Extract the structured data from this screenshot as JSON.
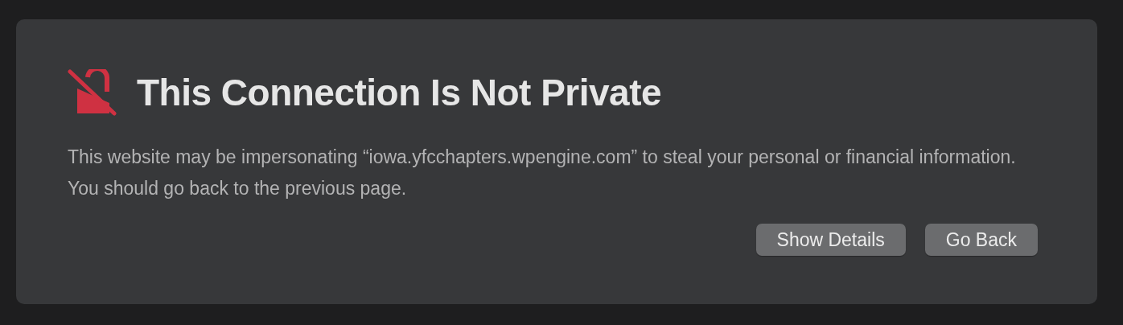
{
  "dialog": {
    "title": "This Connection Is Not Private",
    "message": "This website may be impersonating “iowa.yfcchapters.wpengine.com” to steal your personal or financial information. You should go back to the previous page.",
    "buttons": [
      {
        "label": "Show Details"
      },
      {
        "label": "Go Back"
      }
    ]
  }
}
